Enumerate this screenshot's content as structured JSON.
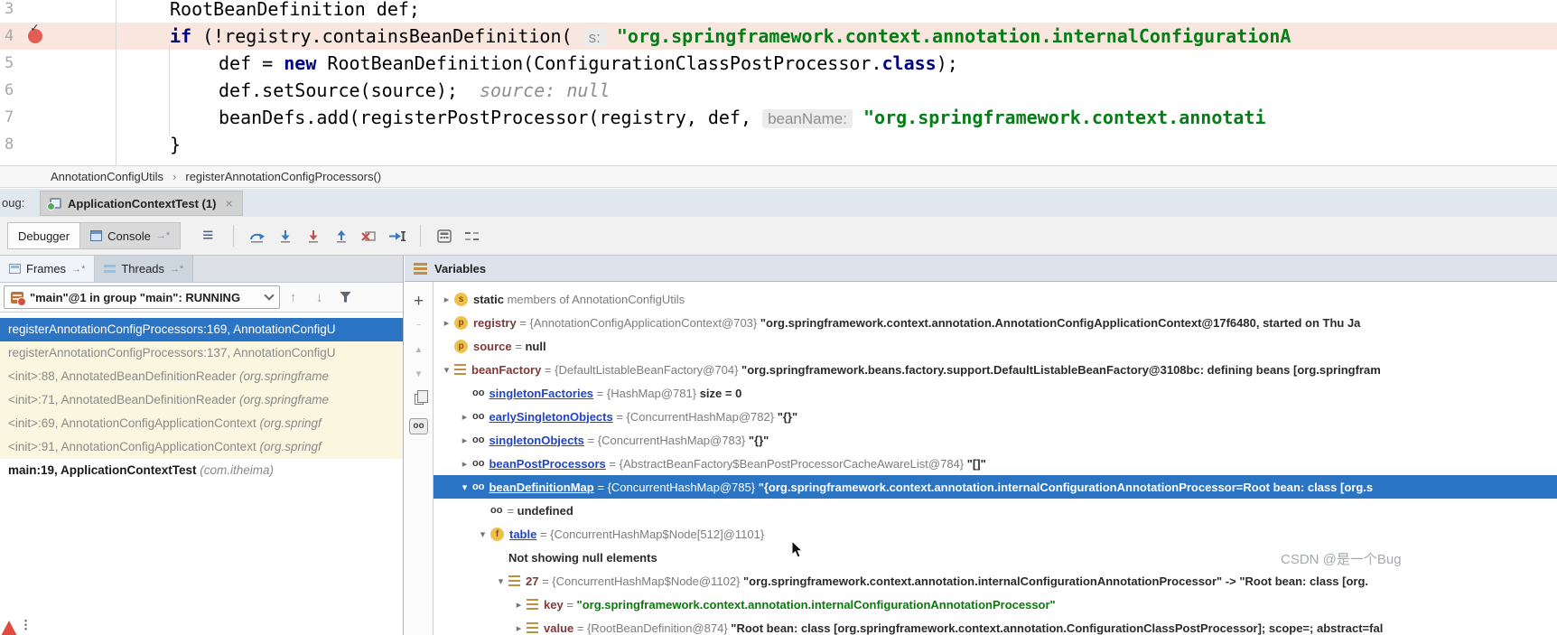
{
  "editor": {
    "lines": [
      {
        "num": "3",
        "indent": "ind1",
        "breakpoint": false,
        "highlight": false,
        "segs": [
          {
            "t": "RootBeanDefinition def;",
            "c": "pl"
          }
        ]
      },
      {
        "num": "4",
        "indent": "ind1",
        "breakpoint": true,
        "highlight": true,
        "segs": [
          {
            "t": "if",
            "c": "kw"
          },
          {
            "t": " (!registry.containsBeanDefinition( ",
            "c": "pl"
          },
          {
            "t": "s:",
            "c": "hint"
          },
          {
            "t": " ",
            "c": "pl"
          },
          {
            "t": "\"org.springframework.context.annotation.internalConfigurationA",
            "c": "str"
          }
        ]
      },
      {
        "num": "5",
        "indent": "ind2",
        "breakpoint": false,
        "highlight": false,
        "segs": [
          {
            "t": "def = ",
            "c": "pl"
          },
          {
            "t": "new",
            "c": "kw"
          },
          {
            "t": " RootBeanDefinition(ConfigurationClassPostProcessor.",
            "c": "pl"
          },
          {
            "t": "class",
            "c": "kw"
          },
          {
            "t": ");",
            "c": "pl"
          }
        ]
      },
      {
        "num": "6",
        "indent": "ind2",
        "breakpoint": false,
        "highlight": false,
        "segs": [
          {
            "t": "def.setSource(source);  ",
            "c": "pl"
          },
          {
            "t": "source: null",
            "c": "ih"
          }
        ]
      },
      {
        "num": "7",
        "indent": "ind2",
        "breakpoint": false,
        "highlight": false,
        "segs": [
          {
            "t": "beanDefs.add(registerPostProcessor(registry, def, ",
            "c": "pl"
          },
          {
            "t": "beanName:",
            "c": "hint"
          },
          {
            "t": " ",
            "c": "pl"
          },
          {
            "t": "\"org.springframework.context.annotati",
            "c": "str"
          }
        ]
      },
      {
        "num": "8",
        "indent": "ind1",
        "breakpoint": false,
        "highlight": false,
        "segs": [
          {
            "t": "}",
            "c": "pl"
          }
        ]
      }
    ]
  },
  "breadcrumb": {
    "class_name": "AnnotationConfigUtils",
    "separator": "›",
    "method_name": "registerAnnotationConfigProcessors()"
  },
  "debug_header": {
    "clipped_label": "oug:",
    "tab_label": "ApplicationContextTest (1)",
    "close": "×"
  },
  "toolbar": {
    "debugger_tab": "Debugger",
    "console_tab": "Console",
    "console_marker": "→*",
    "menu_glyph": "≡",
    "step_icon_names": [
      "step-over-icon",
      "step-into-icon",
      "force-step-into-icon",
      "step-out-icon",
      "drop-frame-icon",
      "run-to-cursor-icon",
      "evaluate-expression-icon",
      "layout-settings-icon"
    ],
    "colors": {
      "step_blue": "#3b79c4",
      "step_red": "#c4524e",
      "icon_gray": "#6e6e6e"
    }
  },
  "frames_panel": {
    "frames_tab": "Frames",
    "threads_tab": "Threads",
    "tab_marker": "→*",
    "thread_selector": "\"main\"@1 in group \"main\": RUNNING",
    "frames": [
      {
        "text": "registerAnnotationConfigProcessors:169, AnnotationConfigU",
        "pkg": "",
        "state": "selected"
      },
      {
        "text": "registerAnnotationConfigProcessors:137, AnnotationConfigU",
        "pkg": "",
        "state": "lib"
      },
      {
        "text": "<init>:88, AnnotatedBeanDefinitionReader ",
        "pkg": "(org.springframe",
        "state": "lib"
      },
      {
        "text": "<init>:71, AnnotatedBeanDefinitionReader ",
        "pkg": "(org.springframe",
        "state": "lib"
      },
      {
        "text": "<init>:69, AnnotationConfigApplicationContext ",
        "pkg": "(org.springf",
        "state": "lib"
      },
      {
        "text": "<init>:91, AnnotationConfigApplicationContext ",
        "pkg": "(org.springf",
        "state": "lib"
      },
      {
        "text": "main:19, ApplicationContextTest ",
        "pkg": "(com.itheima)",
        "state": "user"
      }
    ]
  },
  "variables_panel": {
    "title": "Variables",
    "vertical_toolbar": [
      {
        "name": "add-watch-button",
        "glyph": "+",
        "cls": "big"
      },
      {
        "name": "remove-watch-button",
        "glyph": "−",
        "cls": "big dis"
      },
      {
        "name": "move-up-button",
        "glyph": "▲",
        "cls": "dis"
      },
      {
        "name": "move-down-button",
        "glyph": "▼",
        "cls": "dis"
      },
      {
        "name": "copy-button",
        "glyph": "",
        "cls": "copy"
      },
      {
        "name": "show-watches-button",
        "glyph": "oo",
        "cls": "oo"
      }
    ],
    "rows": [
      {
        "level": 0,
        "chev": "▸",
        "icon": "s",
        "selected": false,
        "segs": [
          {
            "t": "static",
            "c": "b"
          },
          {
            "t": " members of AnnotationConfigUtils",
            "c": "g"
          }
        ]
      },
      {
        "level": 0,
        "chev": "▸",
        "icon": "p",
        "selected": false,
        "segs": [
          {
            "t": "registry",
            "c": "n"
          },
          {
            "t": " = ",
            "c": "g"
          },
          {
            "t": "{AnnotationConfigApplicationContext@703} ",
            "c": "g"
          },
          {
            "t": "\"org.springframework.context.annotation.AnnotationConfigApplicationContext@17f6480, started on Thu Ja",
            "c": "b"
          }
        ]
      },
      {
        "level": 0,
        "chev": "",
        "icon": "p",
        "selected": false,
        "segs": [
          {
            "t": "source",
            "c": "n"
          },
          {
            "t": " = ",
            "c": "g"
          },
          {
            "t": "null",
            "c": "b"
          }
        ]
      },
      {
        "level": 0,
        "chev": "▾",
        "icon": "bars",
        "selected": false,
        "segs": [
          {
            "t": "beanFactory",
            "c": "n"
          },
          {
            "t": " = ",
            "c": "g"
          },
          {
            "t": "{DefaultListableBeanFactory@704} ",
            "c": "g"
          },
          {
            "t": "\"org.springframework.beans.factory.support.DefaultListableBeanFactory@3108bc: defining beans [org.springfram",
            "c": "b"
          }
        ]
      },
      {
        "level": 1,
        "chev": "",
        "icon": "oo",
        "selected": false,
        "segs": [
          {
            "t": "singletonFactories",
            "c": "bl"
          },
          {
            "t": " = ",
            "c": "g"
          },
          {
            "t": "{HashMap@781} ",
            "c": "g"
          },
          {
            "t": "size = 0",
            "c": "b"
          }
        ]
      },
      {
        "level": 1,
        "chev": "▸",
        "icon": "oo",
        "selected": false,
        "segs": [
          {
            "t": "earlySingletonObjects",
            "c": "bl"
          },
          {
            "t": " = ",
            "c": "g"
          },
          {
            "t": "{ConcurrentHashMap@782} ",
            "c": "g"
          },
          {
            "t": "\"{}\"",
            "c": "b"
          }
        ]
      },
      {
        "level": 1,
        "chev": "▸",
        "icon": "oo",
        "selected": false,
        "segs": [
          {
            "t": "singletonObjects",
            "c": "bl"
          },
          {
            "t": " = ",
            "c": "g"
          },
          {
            "t": "{ConcurrentHashMap@783} ",
            "c": "g"
          },
          {
            "t": "\"{}\"",
            "c": "b"
          }
        ]
      },
      {
        "level": 1,
        "chev": "▸",
        "icon": "oo",
        "selected": false,
        "segs": [
          {
            "t": "beanPostProcessors",
            "c": "bl"
          },
          {
            "t": " = ",
            "c": "g"
          },
          {
            "t": "{AbstractBeanFactory$BeanPostProcessorCacheAwareList@784} ",
            "c": "g"
          },
          {
            "t": "\"[]\"",
            "c": "b"
          }
        ]
      },
      {
        "level": 1,
        "chev": "▾",
        "icon": "oo",
        "selected": true,
        "segs": [
          {
            "t": "beanDefinitionMap",
            "c": "bl"
          },
          {
            "t": " = ",
            "c": "g"
          },
          {
            "t": "{ConcurrentHashMap@785} ",
            "c": "g"
          },
          {
            "t": "\"{org.springframework.context.annotation.internalConfigurationAnnotationProcessor=Root bean: class [org.s",
            "c": "b"
          }
        ]
      },
      {
        "level": 2,
        "chev": "",
        "icon": "oo",
        "selected": false,
        "segs": [
          {
            "t": "= ",
            "c": "g"
          },
          {
            "t": "undefined",
            "c": "b"
          }
        ]
      },
      {
        "level": 2,
        "chev": "▾",
        "icon": "f",
        "selected": false,
        "segs": [
          {
            "t": "table",
            "c": "bl"
          },
          {
            "t": " = ",
            "c": "g"
          },
          {
            "t": "{ConcurrentHashMap$Node[512]@1101}",
            "c": "g"
          }
        ]
      },
      {
        "level": 3,
        "chev": "",
        "icon": "",
        "selected": false,
        "segs": [
          {
            "t": "Not showing null elements",
            "c": "b"
          }
        ]
      },
      {
        "level": 3,
        "chev": "▾",
        "icon": "bars",
        "selected": false,
        "segs": [
          {
            "t": "27",
            "c": "n"
          },
          {
            "t": " = ",
            "c": "g"
          },
          {
            "t": "{ConcurrentHashMap$Node@1102} ",
            "c": "g"
          },
          {
            "t": "\"org.springframework.context.annotation.internalConfigurationAnnotationProcessor\" -> \"Root bean: class [org.",
            "c": "b"
          }
        ]
      },
      {
        "level": 4,
        "chev": "▸",
        "icon": "bars",
        "selected": false,
        "segs": [
          {
            "t": "key",
            "c": "n"
          },
          {
            "t": " = ",
            "c": "g"
          },
          {
            "t": "\"org.springframework.context.annotation.internalConfigurationAnnotationProcessor\"",
            "c": "green"
          }
        ]
      },
      {
        "level": 4,
        "chev": "▸",
        "icon": "bars",
        "selected": false,
        "segs": [
          {
            "t": "value",
            "c": "n"
          },
          {
            "t": " = ",
            "c": "g"
          },
          {
            "t": "{RootBeanDefinition@874} ",
            "c": "g"
          },
          {
            "t": "\"Root bean: class [org.springframework.context.annotation.ConfigurationClassPostProcessor]; scope=; abstract=fal",
            "c": "b"
          }
        ]
      }
    ]
  },
  "watermark": "CSDN @是一个Bug"
}
